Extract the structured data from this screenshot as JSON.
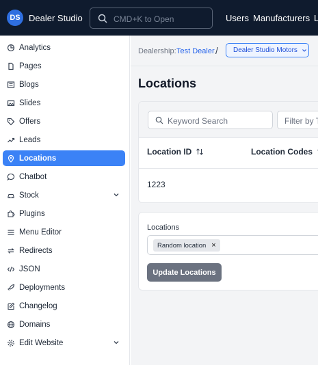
{
  "header": {
    "logo_text": "DS",
    "brand": "Dealer Studio",
    "search_placeholder": "CMD+K to Open",
    "nav": [
      "Users",
      "Manufacturers",
      "L"
    ]
  },
  "sidebar": {
    "items": [
      {
        "label": "Analytics",
        "icon": "chart-pie-icon"
      },
      {
        "label": "Pages",
        "icon": "page-icon"
      },
      {
        "label": "Blogs",
        "icon": "blog-icon"
      },
      {
        "label": "Slides",
        "icon": "image-icon"
      },
      {
        "label": "Offers",
        "icon": "tag-icon"
      },
      {
        "label": "Leads",
        "icon": "trend-icon"
      },
      {
        "label": "Locations",
        "icon": "map-pin-icon",
        "active": true
      },
      {
        "label": "Chatbot",
        "icon": "chat-icon"
      },
      {
        "label": "Stock",
        "icon": "car-icon",
        "expandable": true
      },
      {
        "label": "Plugins",
        "icon": "puzzle-icon"
      },
      {
        "label": "Menu Editor",
        "icon": "menu-icon"
      },
      {
        "label": "Redirects",
        "icon": "redirect-icon"
      },
      {
        "label": "JSON",
        "icon": "code-icon"
      },
      {
        "label": "Deployments",
        "icon": "rocket-icon"
      },
      {
        "label": "Changelog",
        "icon": "edit-icon"
      },
      {
        "label": "Domains",
        "icon": "globe-icon"
      },
      {
        "label": "Edit Website",
        "icon": "gear-icon",
        "expandable": true
      }
    ],
    "active_color": "#3b82f6"
  },
  "breadcrumb": {
    "label": "Dealership:",
    "link": "Test Dealer",
    "separator": "/",
    "current": "Dealer Studio Motors"
  },
  "main": {
    "title": "Locations",
    "keyword_placeholder": "Keyword Search",
    "filter_placeholder": "Filter by T",
    "columns": [
      "Location ID",
      "Location Codes"
    ],
    "rows": [
      {
        "location_id": "1223"
      }
    ],
    "locations_label": "Locations",
    "selected_locations": [
      "Random location"
    ],
    "chip_remove": "×",
    "update_button": "Update Locations"
  }
}
